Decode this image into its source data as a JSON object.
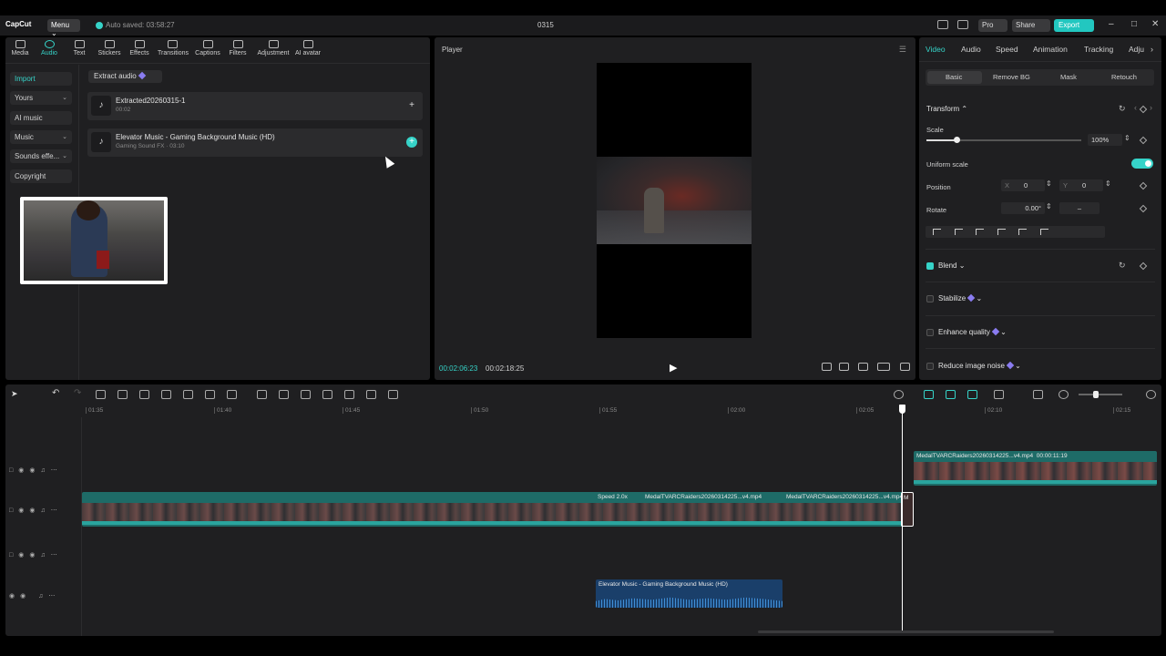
{
  "titlebar": {
    "logo": "CapCut",
    "menu_label": "Menu ⌄",
    "autosave": "Auto saved: 03:58:27",
    "project_title": "0315",
    "pro_label": "Pro",
    "share_label": "Share",
    "export_label": "Export"
  },
  "toolbar": {
    "tabs": [
      {
        "label": "Media"
      },
      {
        "label": "Audio"
      },
      {
        "label": "Text"
      },
      {
        "label": "Stickers"
      },
      {
        "label": "Effects"
      },
      {
        "label": "Transitions"
      },
      {
        "label": "Captions"
      },
      {
        "label": "Filters"
      },
      {
        "label": "Adjustment"
      },
      {
        "label": "AI avatar"
      }
    ],
    "active_tab": "Audio"
  },
  "sidebar": {
    "items": [
      {
        "label": "Import"
      },
      {
        "label": "Yours"
      },
      {
        "label": "AI music"
      },
      {
        "label": "Music"
      },
      {
        "label": "Sounds effe..."
      },
      {
        "label": "Copyright"
      }
    ]
  },
  "library": {
    "extract_label": "Extract audio",
    "items": [
      {
        "title": "Extracted20260315-1",
        "subtitle": "00:02"
      },
      {
        "title": "Elevator Music - Gaming Background Music (HD)",
        "subtitle": "Gaming Sound FX · 03:10"
      }
    ]
  },
  "player": {
    "title": "Player",
    "current_time": "00:02:06:23",
    "total_time": "00:02:18:25"
  },
  "inspector": {
    "tabs": [
      {
        "label": "Video"
      },
      {
        "label": "Audio"
      },
      {
        "label": "Speed"
      },
      {
        "label": "Animation"
      },
      {
        "label": "Tracking"
      },
      {
        "label": "Adju"
      }
    ],
    "subtabs": [
      {
        "label": "Basic"
      },
      {
        "label": "Remove BG"
      },
      {
        "label": "Mask"
      },
      {
        "label": "Retouch"
      }
    ],
    "transform_label": "Transform",
    "scale_label": "Scale",
    "scale_value": "100%",
    "scale_fraction": 0.2,
    "uniform_label": "Uniform scale",
    "position_label": "Position",
    "pos_x_label": "X",
    "pos_x": "0",
    "pos_y_label": "Y",
    "pos_y": "0",
    "rotate_label": "Rotate",
    "rotate_value": "0.00°",
    "rotate_dash": "–",
    "blend_label": "Blend",
    "stabilize_label": "Stabilize",
    "enhance_label": "Enhance quality",
    "noise_label": "Reduce image noise"
  },
  "timeline": {
    "ticks": [
      "01:35",
      "01:40",
      "01:45",
      "01:50",
      "01:55",
      "02:00",
      "02:05",
      "02:10",
      "02:15"
    ],
    "clip_speed": "Speed 2.0x",
    "clip_main_a": "MedalTVARCRaiders20260314225...v4.mp4",
    "clip_main_b": "MedalTVARCRaiders20260314225...v4.mp4",
    "clip_sel": "M",
    "clip_top": "MedalTVARCRaiders20260314225...v4.mp4",
    "clip_top_dur": "00:00:11:19",
    "clip_audio": "Elevator Music - Gaming Background Music (HD)"
  },
  "colors": {
    "accent": "#36d3c8",
    "panel_bg": "#1f1f21",
    "video_clip": "#1e6b67",
    "audio_clip": "#1a3f6a"
  }
}
